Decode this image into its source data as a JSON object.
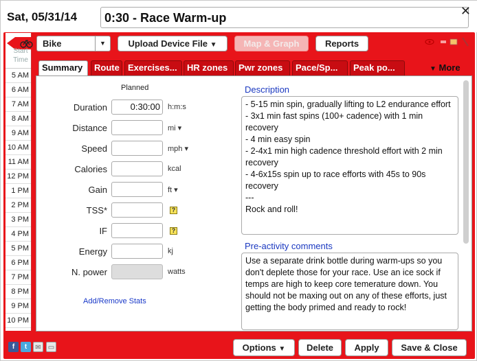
{
  "header": {
    "date": "Sat, 05/31/14",
    "title": "0:30 - Race Warm-up"
  },
  "time_column": {
    "label": "Start Time",
    "hours": [
      "5 AM",
      "6 AM",
      "7 AM",
      "8 AM",
      "9 AM",
      "10 AM",
      "11 AM",
      "12 PM",
      "1 PM",
      "2 PM",
      "3 PM",
      "4 PM",
      "5 PM",
      "6 PM",
      "7 PM",
      "8 PM",
      "9 PM",
      "10 PM"
    ]
  },
  "toolbar": {
    "sport": "Bike",
    "upload": "Upload Device File",
    "map_graph": "Map & Graph",
    "reports": "Reports"
  },
  "tabs": [
    "Summary",
    "Route",
    "Exercises...",
    "HR zones",
    "Pwr zones",
    "Pace/Sp...",
    "Peak po..."
  ],
  "more_label": "More",
  "stats": {
    "planned_label": "Planned",
    "rows": [
      {
        "label": "Duration",
        "value": "0:30:00",
        "unit": "h:m:s"
      },
      {
        "label": "Distance",
        "value": "",
        "unit": "mi"
      },
      {
        "label": "Speed",
        "value": "",
        "unit": "mph"
      },
      {
        "label": "Calories",
        "value": "",
        "unit": "kcal"
      },
      {
        "label": "Gain",
        "value": "",
        "unit": "ft"
      },
      {
        "label": "TSS*",
        "value": "",
        "unit": "?"
      },
      {
        "label": "IF",
        "value": "",
        "unit": "?"
      },
      {
        "label": "Energy",
        "value": "",
        "unit": "kj"
      },
      {
        "label": "N. power",
        "value": "",
        "unit": "watts"
      }
    ],
    "add_remove": "Add/Remove Stats"
  },
  "description": {
    "title": "Description",
    "lines": [
      "- 5-15 min spin, gradually lifting to L2 endurance effort",
      "- 3x1 min fast spins (100+ cadence) with 1 min recovery",
      "- 4 min easy spin",
      "- 2-4x1 min high cadence threshold effort with 2 min recovery",
      "- 4-6x15s spin up to race efforts with 45s to 90s recovery",
      "---",
      "Rock and roll!"
    ]
  },
  "comments": {
    "title": "Pre-activity comments",
    "text": "Use a separate drink bottle during warm-ups so you don't deplete those for your race. Use an ice sock if temps are high to keep core temerature down. You should not be maxing out on any of these efforts, just getting the body primed and ready to rock!"
  },
  "footer": {
    "options": "Options",
    "delete": "Delete",
    "apply": "Apply",
    "save_close": "Save & Close"
  },
  "colors": {
    "accent": "#e8141a",
    "link": "#1a38c0"
  }
}
